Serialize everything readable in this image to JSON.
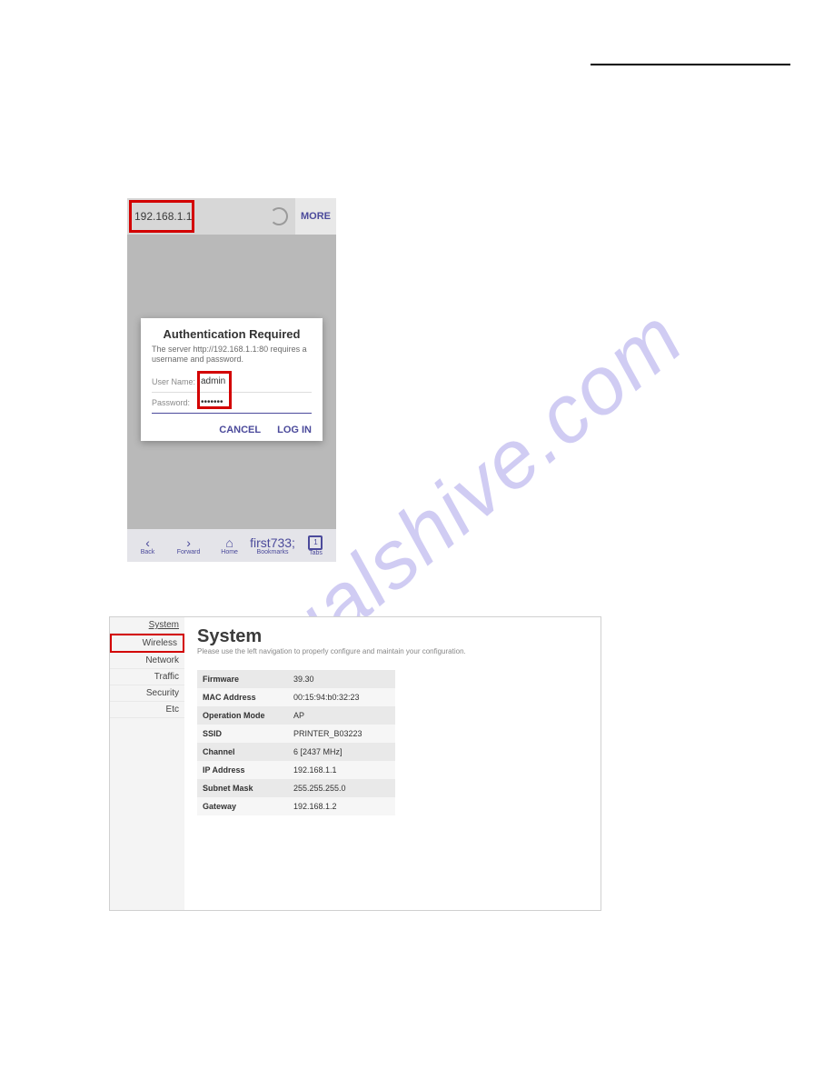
{
  "watermark": "manualshive.com",
  "phone": {
    "url": "192.168.1.1",
    "moreLabel": "MORE",
    "dialog": {
      "title": "Authentication Required",
      "message": "The server http://192.168.1.1:80 requires a username and password.",
      "userLabel": "User Name:",
      "userValue": "admin",
      "passLabel": "Password:",
      "passValue": "•••••••",
      "cancel": "CANCEL",
      "login": "LOG IN"
    },
    "nav": {
      "back": "Back",
      "forward": "Forward",
      "home": "Home",
      "bookmarks": "Bookmarks",
      "tabs": "Tabs",
      "tabCount": "1"
    }
  },
  "router": {
    "side": {
      "system": "System",
      "wireless": "Wireless",
      "network": "Network",
      "traffic": "Traffic",
      "security": "Security",
      "etc": "Etc"
    },
    "title": "System",
    "subtitle": "Please use the left navigation to properly configure and maintain your configuration.",
    "rows": [
      {
        "k": "Firmware",
        "v": "39.30"
      },
      {
        "k": "MAC Address",
        "v": "00:15:94:b0:32:23"
      },
      {
        "k": "Operation Mode",
        "v": "AP"
      },
      {
        "k": "SSID",
        "v": "PRINTER_B03223"
      },
      {
        "k": "Channel",
        "v": "6 [2437 MHz]"
      },
      {
        "k": "IP Address",
        "v": "192.168.1.1"
      },
      {
        "k": "Subnet Mask",
        "v": "255.255.255.0"
      },
      {
        "k": "Gateway",
        "v": "192.168.1.2"
      }
    ]
  }
}
